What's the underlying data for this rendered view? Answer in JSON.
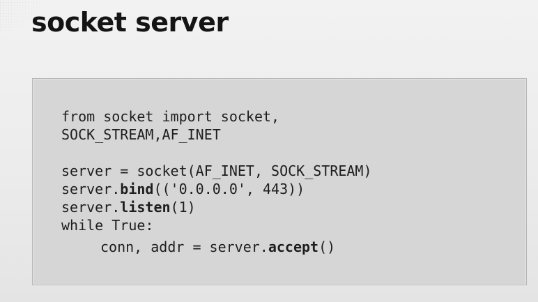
{
  "slide": {
    "title": "socket server"
  },
  "code": {
    "lines": [
      {
        "parts": [
          "from socket import socket,"
        ]
      },
      {
        "parts": [
          "SOCK_STREAM,AF_INET"
        ]
      },
      {
        "parts": [
          ""
        ]
      },
      {
        "parts": [
          "server = socket(AF_INET, SOCK_STREAM)"
        ]
      },
      {
        "parts": [
          "server.",
          "bind",
          "(('0.0.0.0', 443))"
        ]
      },
      {
        "parts": [
          "server.",
          "listen",
          "(1)"
        ]
      },
      {
        "parts": [
          "while True:"
        ]
      },
      {
        "parts": [
          "conn, addr = server.",
          "accept",
          "()"
        ]
      }
    ]
  }
}
